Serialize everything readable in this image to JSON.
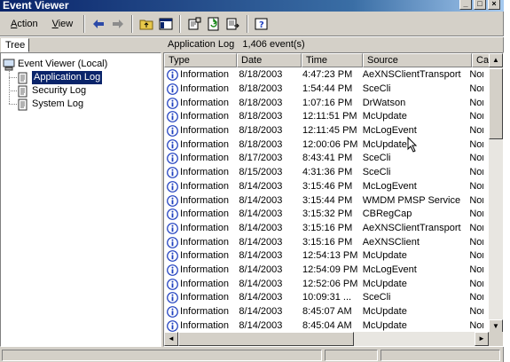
{
  "window": {
    "title": "Event Viewer"
  },
  "menu": {
    "action": "Action",
    "action_key": "A",
    "action_rest": "ction",
    "view": "View",
    "view_key": "V",
    "view_rest": "iew"
  },
  "tree": {
    "tab": "Tree",
    "root": "Event Viewer (Local)",
    "items": [
      "Application Log",
      "Security Log",
      "System Log"
    ]
  },
  "list": {
    "header": "Application Log   1,406 event(s)",
    "columns": [
      "Type",
      "Date",
      "Time",
      "Source",
      "Cat"
    ],
    "rows": [
      {
        "type": "Information",
        "date": "8/18/2003",
        "time": "4:47:23 PM",
        "source": "AeXNSClientTransport",
        "cat": "Nor"
      },
      {
        "type": "Information",
        "date": "8/18/2003",
        "time": "1:54:44 PM",
        "source": "SceCli",
        "cat": "Nor"
      },
      {
        "type": "Information",
        "date": "8/18/2003",
        "time": "1:07:16 PM",
        "source": "DrWatson",
        "cat": "Nor"
      },
      {
        "type": "Information",
        "date": "8/18/2003",
        "time": "12:11:51 PM",
        "source": "McUpdate",
        "cat": "Nor"
      },
      {
        "type": "Information",
        "date": "8/18/2003",
        "time": "12:11:45 PM",
        "source": "McLogEvent",
        "cat": "Nor"
      },
      {
        "type": "Information",
        "date": "8/18/2003",
        "time": "12:00:06 PM",
        "source": "McUpdate",
        "cat": "Nor"
      },
      {
        "type": "Information",
        "date": "8/17/2003",
        "time": "8:43:41 PM",
        "source": "SceCli",
        "cat": "Nor"
      },
      {
        "type": "Information",
        "date": "8/15/2003",
        "time": "4:31:36 PM",
        "source": "SceCli",
        "cat": "Nor"
      },
      {
        "type": "Information",
        "date": "8/14/2003",
        "time": "3:15:46 PM",
        "source": "McLogEvent",
        "cat": "Nor"
      },
      {
        "type": "Information",
        "date": "8/14/2003",
        "time": "3:15:44 PM",
        "source": "WMDM PMSP Service",
        "cat": "Nor"
      },
      {
        "type": "Information",
        "date": "8/14/2003",
        "time": "3:15:32 PM",
        "source": "CBRegCap",
        "cat": "Nor"
      },
      {
        "type": "Information",
        "date": "8/14/2003",
        "time": "3:15:16 PM",
        "source": "AeXNSClientTransport",
        "cat": "Nor"
      },
      {
        "type": "Information",
        "date": "8/14/2003",
        "time": "3:15:16 PM",
        "source": "AeXNSClient",
        "cat": "Nor"
      },
      {
        "type": "Information",
        "date": "8/14/2003",
        "time": "12:54:13 PM",
        "source": "McUpdate",
        "cat": "Nor"
      },
      {
        "type": "Information",
        "date": "8/14/2003",
        "time": "12:54:09 PM",
        "source": "McLogEvent",
        "cat": "Nor"
      },
      {
        "type": "Information",
        "date": "8/14/2003",
        "time": "12:52:06 PM",
        "source": "McUpdate",
        "cat": "Nor"
      },
      {
        "type": "Information",
        "date": "8/14/2003",
        "time": "10:09:31 ...",
        "source": "SceCli",
        "cat": "Nor"
      },
      {
        "type": "Information",
        "date": "8/14/2003",
        "time": "8:45:07 AM",
        "source": "McUpdate",
        "cat": "Nor"
      },
      {
        "type": "Information",
        "date": "8/14/2003",
        "time": "8:45:04 AM",
        "source": "McUpdate",
        "cat": "Nor"
      }
    ]
  },
  "colors": {
    "title_start": "#0a246a",
    "title_end": "#a6caf0",
    "face": "#d4d0c8",
    "selection": "#0a246a",
    "info_icon": "#1f3fbf"
  },
  "icons": [
    "back-arrow-icon",
    "forward-arrow-icon",
    "up-folder-icon",
    "show-hide-tree-icon",
    "properties-icon",
    "refresh-icon",
    "export-list-icon",
    "help-icon",
    "information-icon",
    "log-file-icon",
    "computer-icon"
  ]
}
